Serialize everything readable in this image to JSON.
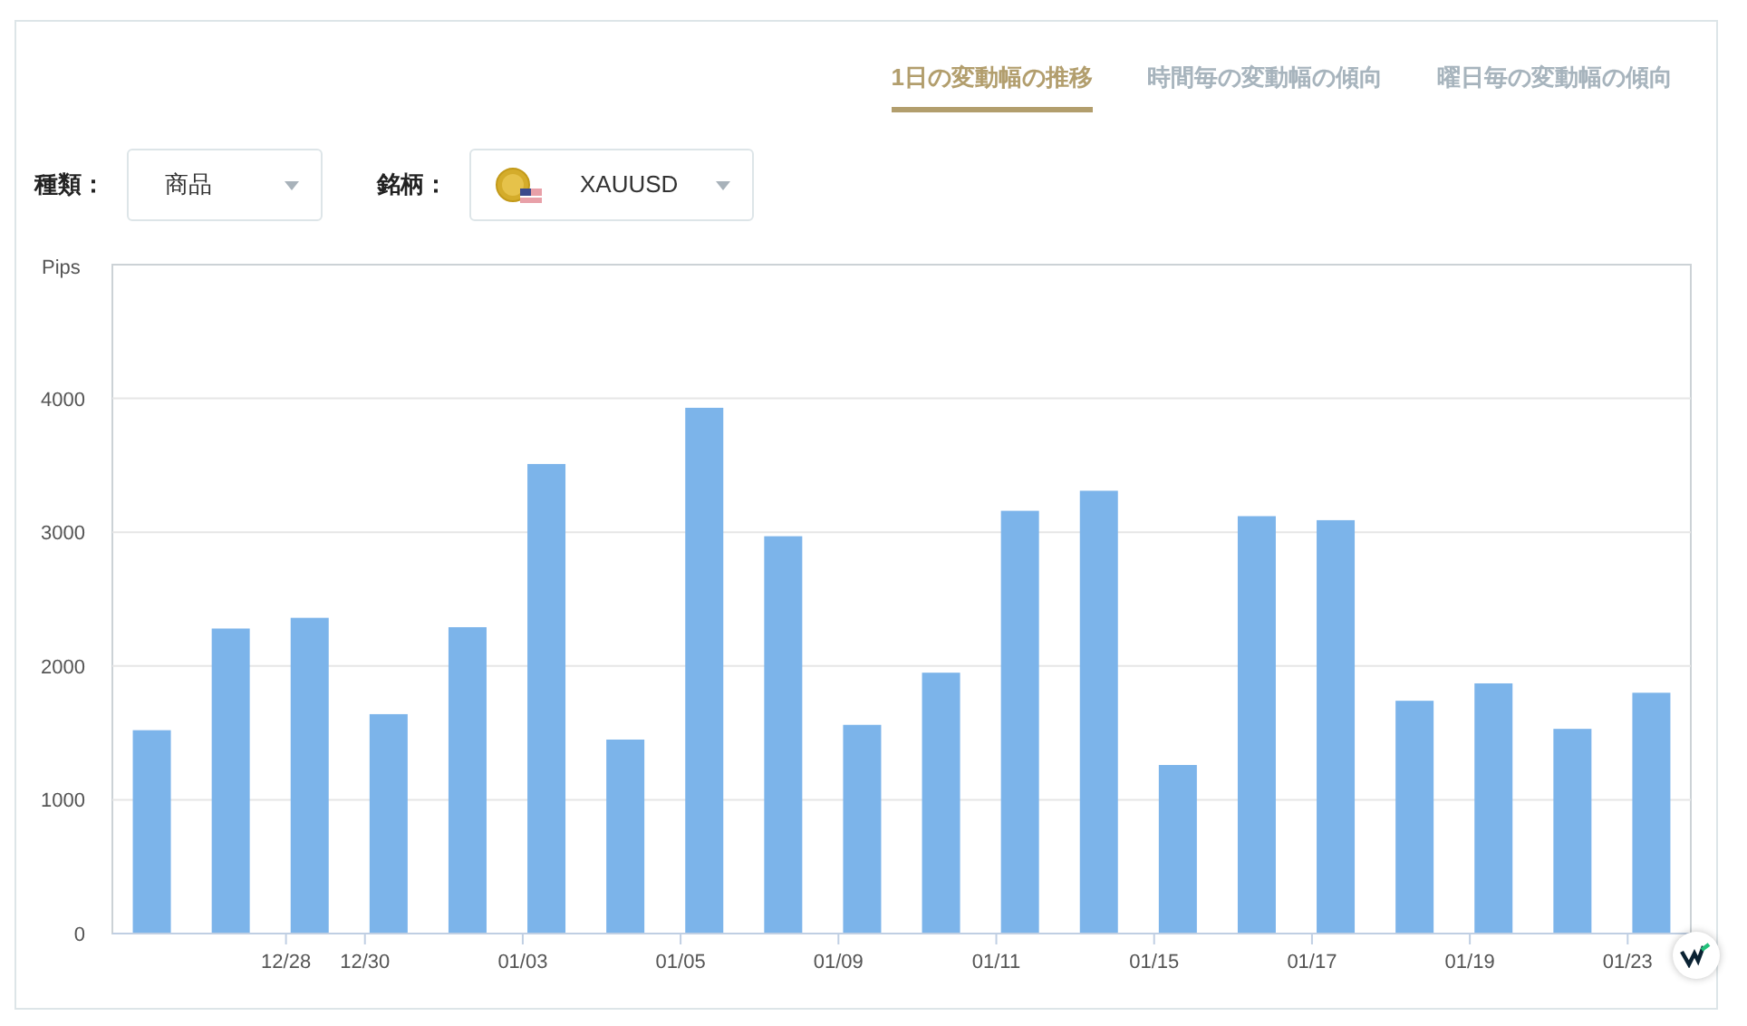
{
  "tabs": [
    {
      "label": "1日の変動幅の推移",
      "selected": true
    },
    {
      "label": "時間毎の変動幅の傾向",
      "selected": false
    },
    {
      "label": "曜日毎の変動幅の傾向",
      "selected": false
    }
  ],
  "filters": [
    {
      "label": "種類：",
      "value": "商品",
      "kind": "plain"
    },
    {
      "label": "銘柄：",
      "value": "XAUUSD",
      "kind": "symbol"
    }
  ],
  "chart_data": {
    "type": "bar",
    "ylabel": "Pips",
    "ylim": [
      0,
      5000
    ],
    "yticks": [
      0,
      1000,
      2000,
      3000,
      4000
    ],
    "grid": true,
    "categories": [
      null,
      null,
      "12/28",
      "12/30",
      null,
      "01/03",
      null,
      "01/05",
      null,
      "01/09",
      null,
      "01/11",
      null,
      "01/15",
      null,
      "01/17",
      null,
      "01/19",
      null,
      "01/23"
    ],
    "series": [
      {
        "color": "#7cb4ea",
        "values": [
          1520,
          2280,
          2360,
          1640,
          2290,
          3510,
          1450,
          3930,
          2970,
          1560,
          1950,
          3160,
          3310,
          1260,
          3120,
          3090,
          1740,
          1870,
          1530,
          1800
        ]
      }
    ]
  }
}
